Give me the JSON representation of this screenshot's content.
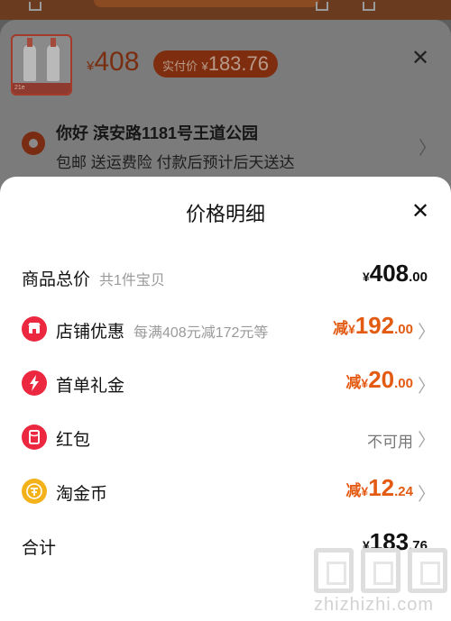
{
  "background": {
    "thumbnail_caption": "21e",
    "price": {
      "currency": "¥",
      "amount": "408"
    },
    "paid": {
      "label": "实付价",
      "currency": "¥",
      "amount": "183.76"
    },
    "address": "你好 滨安路1181号王道公园",
    "services": "包邮  送运费险  付款后预计后天送达"
  },
  "sheet": {
    "title": "价格明细",
    "rows": [
      {
        "label": "商品总价",
        "sub": "共1件宝贝",
        "prefix": "",
        "currency": "¥",
        "int": "408",
        "dec": ".00",
        "icon": ""
      },
      {
        "label": "店铺优惠",
        "sub": "每满408元减172元等",
        "prefix": "减",
        "currency": "¥",
        "int": "192",
        "dec": ".00",
        "icon": "shop-icon"
      },
      {
        "label": "首单礼金",
        "sub": "",
        "prefix": "减",
        "currency": "¥",
        "int": "20",
        "dec": ".00",
        "icon": "lightning-icon"
      },
      {
        "label": "红包",
        "sub": "",
        "status": "不可用",
        "icon": "red-packet-icon"
      },
      {
        "label": "淘金币",
        "sub": "",
        "prefix": "减",
        "currency": "¥",
        "int": "12",
        "dec": ".24",
        "icon": "coin-icon"
      },
      {
        "label": "合计",
        "sub": "",
        "prefix": "",
        "currency": "¥",
        "int": "183",
        "dec": ".76",
        "icon": ""
      }
    ]
  },
  "watermark": "zhizhizhi.com",
  "colors": {
    "accent": "#e35a12",
    "icon_red": "#ec2740",
    "icon_gold": "#f4b21a"
  }
}
